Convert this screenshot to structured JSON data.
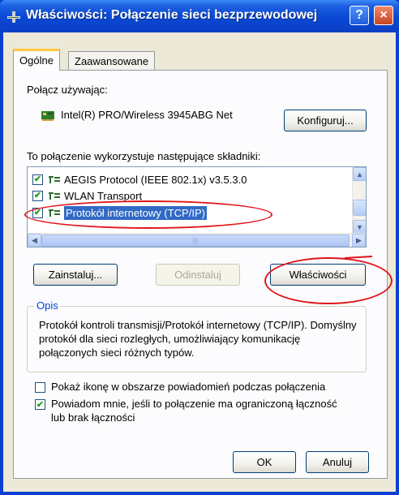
{
  "window": {
    "title": "Właściwości: Połączenie sieci bezprzewodowej",
    "help_button": "?",
    "close_button": "×"
  },
  "tabs": [
    {
      "label": "Ogólne",
      "active": true
    },
    {
      "label": "Zaawansowane",
      "active": false
    }
  ],
  "connect_using": {
    "label": "Połącz używając:",
    "adapter": "Intel(R) PRO/Wireless 3945ABG Net",
    "configure_button": "Konfiguruj..."
  },
  "components": {
    "label": "To połączenie wykorzystuje następujące składniki:",
    "items": [
      {
        "label": "AEGIS Protocol (IEEE 802.1x) v3.5.3.0",
        "checked": true,
        "selected": false
      },
      {
        "label": "WLAN Transport",
        "checked": true,
        "selected": false
      },
      {
        "label": "Protokół internetowy (TCP/IP)",
        "checked": true,
        "selected": true
      }
    ]
  },
  "buttons": {
    "install": "Zainstaluj...",
    "uninstall": "Odinstaluj",
    "properties": "Właściwości",
    "ok": "OK",
    "cancel": "Anuluj"
  },
  "description": {
    "title": "Opis",
    "text": "Protokół kontroli transmisji/Protokół internetowy (TCP/IP). Domyślny protokół dla sieci rozległych, umożliwiający komunikację połączonych sieci różnych typów."
  },
  "options": {
    "show_icon": {
      "label": "Pokaż ikonę w obszarze powiadomień podczas połączenia",
      "checked": false
    },
    "notify_line1": "Powiadom mnie, jeśli to połączenie ma ograniczoną łączność",
    "notify_line2": "lub brak łączności",
    "notify_checked": true
  },
  "colors": {
    "titlebar": "#0a48d4",
    "selection": "#316ac5",
    "annotation": "#e0161b",
    "dialog": "#ece9d8"
  }
}
